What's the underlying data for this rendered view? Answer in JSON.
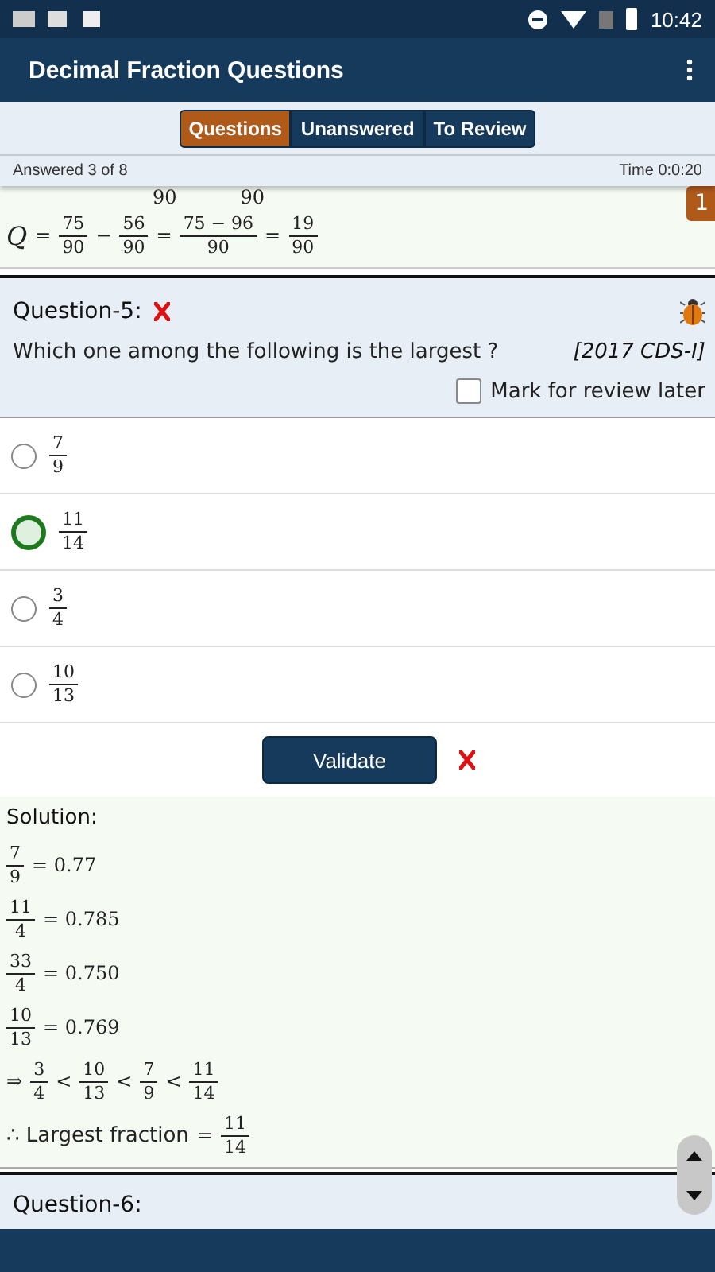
{
  "status_bar": {
    "time": "10:42"
  },
  "app_bar": {
    "title": "Decimal Fraction Questions"
  },
  "tabs": [
    {
      "label": "Questions",
      "selected": true
    },
    {
      "label": "Unanswered",
      "selected": false
    },
    {
      "label": "To Review",
      "selected": false
    }
  ],
  "progress": {
    "answered": "Answered 3 of 8",
    "time": "Time 0:0:20"
  },
  "previous_solution": {
    "cut_fragments": [
      "90",
      "90"
    ],
    "equation": [
      {
        "kind": "var",
        "text": "Q"
      },
      {
        "kind": "op",
        "text": "="
      },
      {
        "kind": "frac",
        "num": "75",
        "den": "90"
      },
      {
        "kind": "op",
        "text": "−"
      },
      {
        "kind": "frac",
        "num": "56",
        "den": "90"
      },
      {
        "kind": "op",
        "text": "="
      },
      {
        "kind": "frac",
        "num": "75 − 96",
        "den": "90"
      },
      {
        "kind": "op",
        "text": "="
      },
      {
        "kind": "frac",
        "num": "19",
        "den": "90"
      }
    ]
  },
  "page_badge": "1",
  "question": {
    "title": "Question-5:",
    "wrong": true,
    "text": "Which one among the following is the largest ?",
    "source": "[2017 CDS-I]",
    "review": {
      "label": "Mark for review later",
      "checked": false
    }
  },
  "options": [
    {
      "num": "7",
      "den": "9",
      "selected": false
    },
    {
      "num": "11",
      "den": "14",
      "selected": true
    },
    {
      "num": "3",
      "den": "4",
      "selected": false
    },
    {
      "num": "10",
      "den": "13",
      "selected": false
    }
  ],
  "validate": {
    "label": "Validate",
    "wrong": true
  },
  "solution": {
    "title": "Solution:",
    "lines": [
      [
        {
          "kind": "frac",
          "num": "7",
          "den": "9"
        },
        {
          "kind": "op",
          "text": "= 0.77"
        }
      ],
      [
        {
          "kind": "frac",
          "num": "11",
          "den": "4"
        },
        {
          "kind": "op",
          "text": "= 0.785"
        }
      ],
      [
        {
          "kind": "frac",
          "num": "33",
          "den": "4"
        },
        {
          "kind": "op",
          "text": "= 0.750"
        }
      ],
      [
        {
          "kind": "frac",
          "num": "10",
          "den": "13"
        },
        {
          "kind": "op",
          "text": "= 0.769"
        }
      ],
      [
        {
          "kind": "op",
          "text": "⇒"
        },
        {
          "kind": "frac",
          "num": "3",
          "den": "4"
        },
        {
          "kind": "op",
          "text": "<"
        },
        {
          "kind": "frac",
          "num": "10",
          "den": "13"
        },
        {
          "kind": "op",
          "text": "<"
        },
        {
          "kind": "frac",
          "num": "7",
          "den": "9"
        },
        {
          "kind": "op",
          "text": "<"
        },
        {
          "kind": "frac",
          "num": "11",
          "den": "14"
        }
      ],
      [
        {
          "kind": "text",
          "text": "∴ Largest fraction"
        },
        {
          "kind": "op",
          "text": "="
        },
        {
          "kind": "frac",
          "num": "11",
          "den": "14"
        }
      ]
    ]
  },
  "next_question": {
    "title": "Question-6:"
  }
}
